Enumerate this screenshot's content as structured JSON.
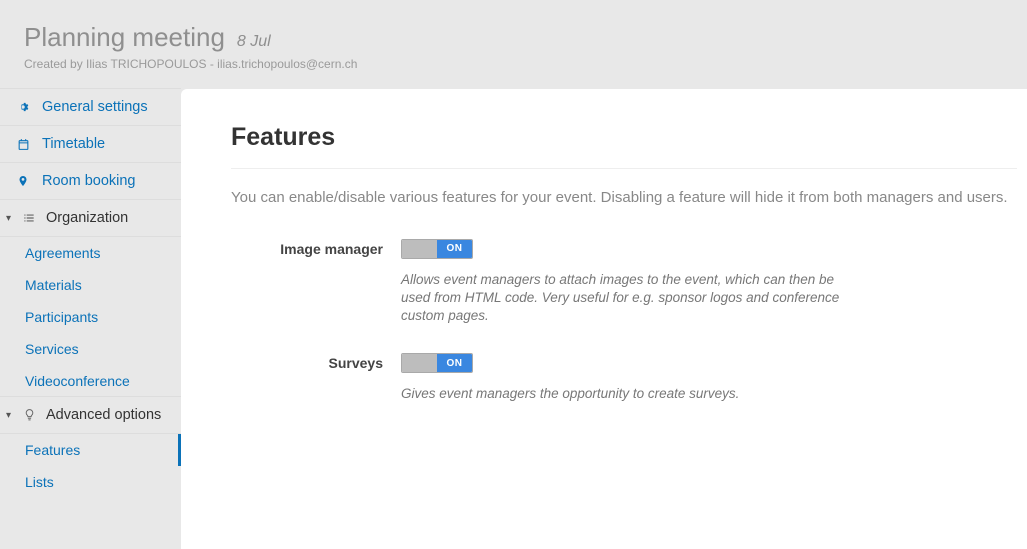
{
  "header": {
    "title": "Planning meeting",
    "date": "8 Jul",
    "creator": "Created by Ilias TRICHOPOULOS - ilias.trichopoulos@cern.ch"
  },
  "sidebar": {
    "general_settings": "General settings",
    "timetable": "Timetable",
    "room_booking": "Room booking",
    "organization": "Organization",
    "org_items": {
      "agreements": "Agreements",
      "materials": "Materials",
      "participants": "Participants",
      "services": "Services",
      "videoconference": "Videoconference"
    },
    "advanced_options": "Advanced options",
    "adv_items": {
      "features": "Features",
      "lists": "Lists"
    }
  },
  "content": {
    "title": "Features",
    "intro": "You can enable/disable various features for your event. Disabling a feature will hide it from both managers and users.",
    "features": {
      "image_manager": {
        "label": "Image manager",
        "state": "ON",
        "desc": "Allows event managers to attach images to the event, which can then be used from HTML code. Very useful for e.g. sponsor logos and conference custom pages."
      },
      "surveys": {
        "label": "Surveys",
        "state": "ON",
        "desc": "Gives event managers the opportunity to create surveys."
      }
    }
  }
}
